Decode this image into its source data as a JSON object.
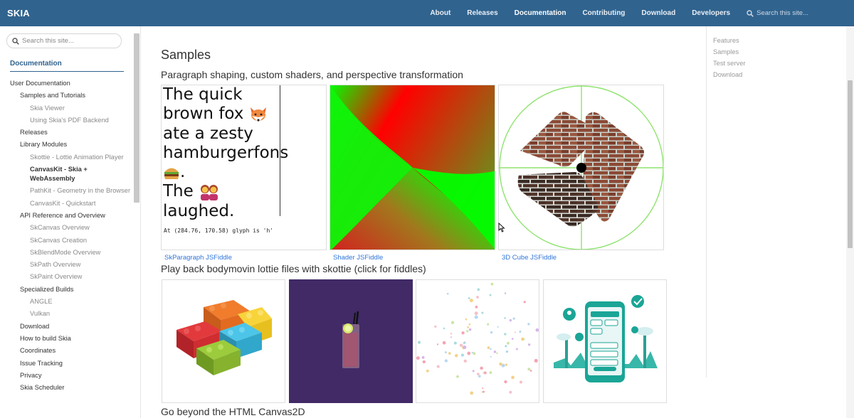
{
  "header": {
    "brand": "SKIA",
    "nav": [
      {
        "label": "About"
      },
      {
        "label": "Releases"
      },
      {
        "label": "Documentation"
      },
      {
        "label": "Contributing"
      },
      {
        "label": "Download"
      },
      {
        "label": "Developers"
      }
    ],
    "search_placeholder": "Search this site..."
  },
  "sidebar": {
    "search_placeholder": "Search this site...",
    "title": "Documentation",
    "items": [
      {
        "label": "User Documentation",
        "level": 1
      },
      {
        "label": "Samples and Tutorials",
        "level": 2
      },
      {
        "label": "Skia Viewer",
        "level": 3
      },
      {
        "label": "Using Skia's PDF Backend",
        "level": 3
      },
      {
        "label": "Releases",
        "level": 2
      },
      {
        "label": "Library Modules",
        "level": 2
      },
      {
        "label": "Skottie - Lottie Animation Player",
        "level": 3
      },
      {
        "label": "CanvasKit - Skia + WebAssembly",
        "level": 3,
        "current": true
      },
      {
        "label": "PathKit - Geometry in the Browser",
        "level": 3
      },
      {
        "label": "CanvasKit - Quickstart",
        "level": 3
      },
      {
        "label": "API Reference and Overview",
        "level": 2
      },
      {
        "label": "SkCanvas Overview",
        "level": 3
      },
      {
        "label": "SkCanvas Creation",
        "level": 3
      },
      {
        "label": "SkBlendMode Overview",
        "level": 3
      },
      {
        "label": "SkPath Overview",
        "level": 3
      },
      {
        "label": "SkPaint Overview",
        "level": 3
      },
      {
        "label": "Specialized Builds",
        "level": 2
      },
      {
        "label": "ANGLE",
        "level": 3
      },
      {
        "label": "Vulkan",
        "level": 3
      },
      {
        "label": "Download",
        "level": 2
      },
      {
        "label": "How to build Skia",
        "level": 2
      },
      {
        "label": "Coordinates",
        "level": 2
      },
      {
        "label": "Issue Tracking",
        "level": 2
      },
      {
        "label": "Privacy",
        "level": 2
      },
      {
        "label": "Skia Scheduler",
        "level": 2
      }
    ]
  },
  "main": {
    "title": "Samples",
    "section1": "Paragraph shaping, custom shaders, and perspective transformation",
    "paragraph_demo": {
      "lines": [
        "The quick",
        "brown fox",
        "ate a zesty",
        "hamburgerfons",
        ".",
        "The",
        "laughed."
      ],
      "status": "At (284.76, 170.58) glyph is 'h'"
    },
    "fiddles": [
      "SkParagraph JSFiddle",
      "Shader JSFiddle",
      "3D Cube JSFiddle"
    ],
    "section2": "Play back bodymovin lottie files with skottie (click for fiddles)",
    "section3": "Go beyond the HTML Canvas2D"
  },
  "toc": [
    "Features",
    "Samples",
    "Test server",
    "Download"
  ],
  "colors": {
    "nav_bg": "#30638e",
    "link": "#3176d9",
    "lottie_purple": "#412a66"
  }
}
